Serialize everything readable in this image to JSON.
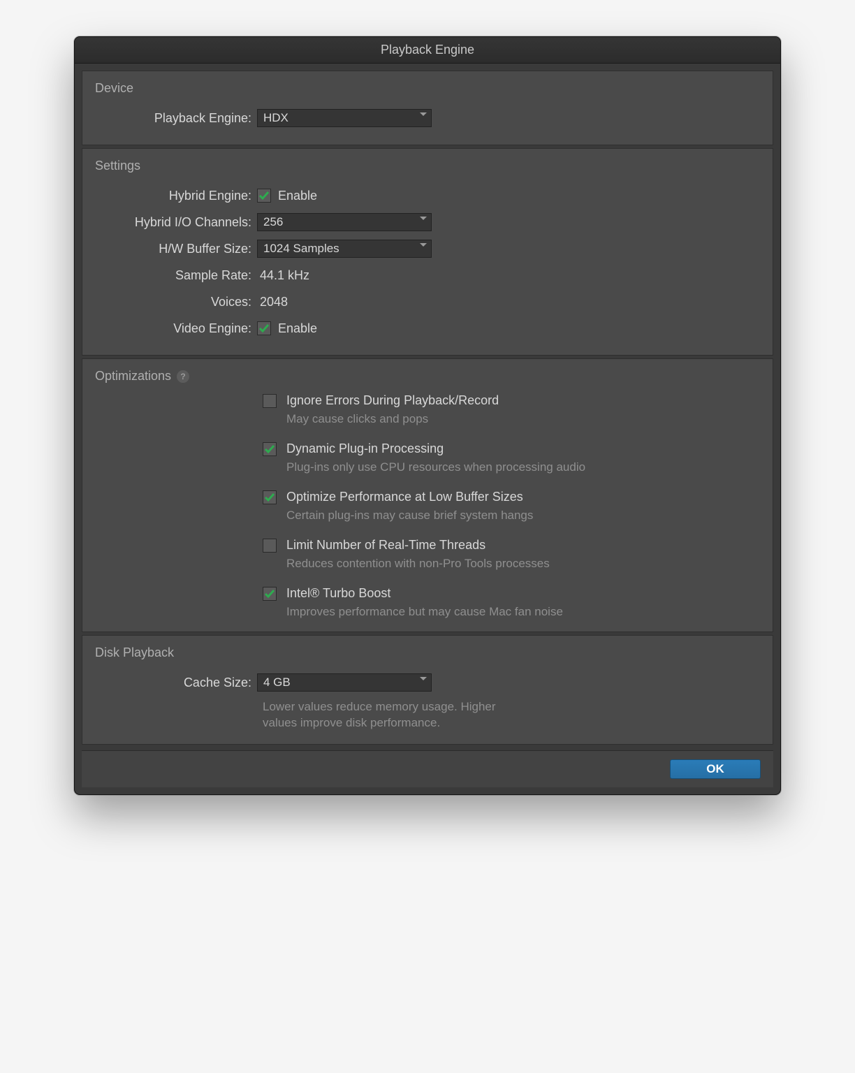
{
  "window": {
    "title": "Playback Engine"
  },
  "device": {
    "heading": "Device",
    "playback_engine_label": "Playback Engine:",
    "playback_engine_value": "HDX"
  },
  "settings": {
    "heading": "Settings",
    "hybrid_engine_label": "Hybrid Engine:",
    "hybrid_engine_enable": "Enable",
    "hybrid_engine_checked": true,
    "hybrid_io_label": "Hybrid I/O Channels:",
    "hybrid_io_value": "256",
    "hw_buffer_label": "H/W Buffer Size:",
    "hw_buffer_value": "1024 Samples",
    "sample_rate_label": "Sample Rate:",
    "sample_rate_value": "44.1 kHz",
    "voices_label": "Voices:",
    "voices_value": "2048",
    "video_engine_label": "Video Engine:",
    "video_engine_enable": "Enable",
    "video_engine_checked": true
  },
  "optimizations": {
    "heading": "Optimizations",
    "help": "?",
    "items": [
      {
        "label": "Ignore Errors During Playback/Record",
        "desc": "May cause clicks and pops",
        "checked": false
      },
      {
        "label": "Dynamic Plug-in Processing",
        "desc": "Plug-ins only use CPU resources when processing audio",
        "checked": true
      },
      {
        "label": "Optimize Performance at Low Buffer Sizes",
        "desc": "Certain plug-ins may cause brief system hangs",
        "checked": true
      },
      {
        "label": "Limit Number of Real-Time Threads",
        "desc": "Reduces contention with non-Pro Tools processes",
        "checked": false
      },
      {
        "label": "Intel® Turbo Boost",
        "desc": "Improves performance but may cause Mac fan noise",
        "checked": true
      }
    ]
  },
  "disk": {
    "heading": "Disk Playback",
    "cache_label": "Cache Size:",
    "cache_value": "4 GB",
    "note": "Lower values reduce memory usage. Higher values improve disk performance."
  },
  "footer": {
    "ok": "OK"
  }
}
